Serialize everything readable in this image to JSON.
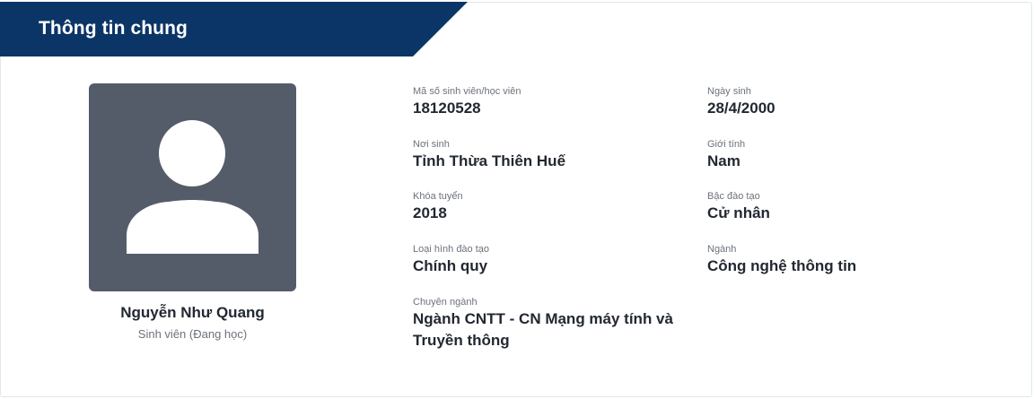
{
  "section": {
    "title": "Thông tin chung",
    "header_color": "#0b3566"
  },
  "profile": {
    "avatar_icon": "user-silhouette-icon",
    "name": "Nguyễn Như Quang",
    "status": "Sinh viên (Đang học)"
  },
  "fields": {
    "student_id": {
      "label": "Mã số sinh viên/học viên",
      "value": "18120528"
    },
    "birth_date": {
      "label": "Ngày sinh",
      "value": "28/4/2000"
    },
    "birth_place": {
      "label": "Nơi sinh",
      "value": "Tỉnh Thừa Thiên Huế"
    },
    "gender": {
      "label": "Giới tính",
      "value": "Nam"
    },
    "cohort": {
      "label": "Khóa tuyển",
      "value": "2018"
    },
    "degree_level": {
      "label": "Bậc đào tạo",
      "value": "Cử nhân"
    },
    "training_type": {
      "label": "Loại hình đào tạo",
      "value": "Chính quy"
    },
    "major": {
      "label": "Ngành",
      "value": "Công nghệ thông tin"
    },
    "specialization": {
      "label": "Chuyên ngành",
      "value": "Ngành CNTT - CN Mạng máy tính và Truyền thông"
    }
  }
}
